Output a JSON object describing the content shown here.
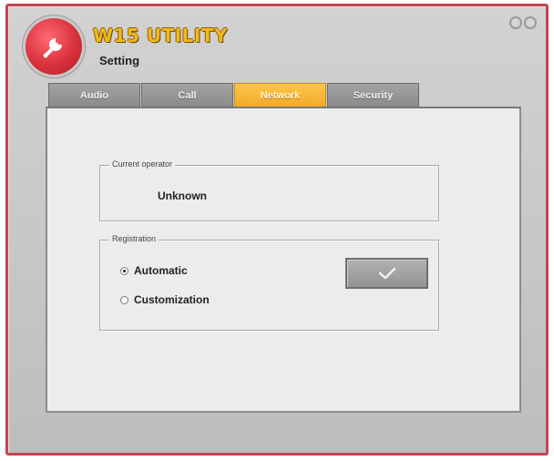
{
  "app": {
    "title": "W15 UTILITY",
    "subtitle": "Setting"
  },
  "tabs": [
    {
      "label": "Audio",
      "active": false
    },
    {
      "label": "Call",
      "active": false
    },
    {
      "label": "Network",
      "active": true
    },
    {
      "label": "Security",
      "active": false
    }
  ],
  "current_operator": {
    "legend": "Current operator",
    "value": "Unknown"
  },
  "registration": {
    "legend": "Registration",
    "options": [
      {
        "label": "Automatic",
        "selected": true
      },
      {
        "label": "Customization",
        "selected": false
      }
    ]
  },
  "icons": {
    "logo": "wrench-icon",
    "confirm": "check-icon",
    "window_controls": [
      "minimize-icon",
      "close-icon"
    ]
  },
  "colors": {
    "window_border": "#c44453",
    "active_tab": "#f0a92b",
    "title": "#f1b71f",
    "logo": "#d8313c"
  }
}
